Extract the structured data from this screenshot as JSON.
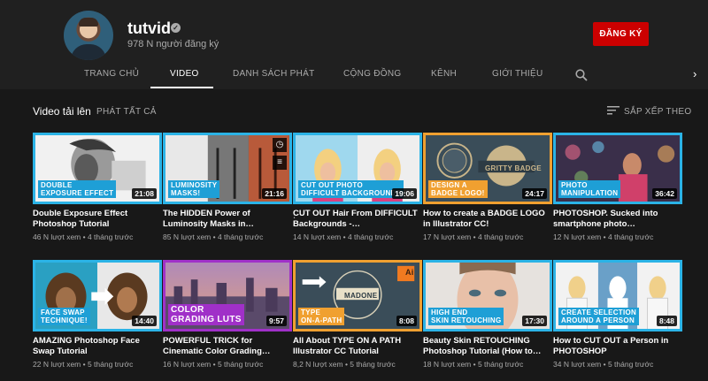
{
  "channel": {
    "name": "tutvid",
    "subscribers": "978 N người đăng ký",
    "subscribe_label": "ĐĂNG KÝ"
  },
  "tabs": [
    {
      "label": "TRANG CHỦ"
    },
    {
      "label": "VIDEO"
    },
    {
      "label": "DANH SÁCH PHÁT"
    },
    {
      "label": "CỘNG ĐỒNG"
    },
    {
      "label": "KÊNH"
    },
    {
      "label": "GIỚI THIỆU"
    }
  ],
  "active_tab": "VIDEO",
  "section": {
    "title": "Video tải lên",
    "play_all": "PHÁT TẤT CẢ",
    "sort_label": "SẮP XẾP THEO"
  },
  "icons": [
    "verified-check-icon",
    "search-icon",
    "chevron-right-icon",
    "sort-icon",
    "clock-icon",
    "add-to-queue-icon",
    "kebab-menu-icon"
  ],
  "videos": [
    {
      "title": "Double Exposure Effect Photoshop Tutorial",
      "meta": "46 N lượt xem • 4 tháng trước",
      "duration": "21:08",
      "badge": "DOUBLE\nEXPOSURE EFFECT"
    },
    {
      "title": "The HIDDEN Power of Luminosity Masks in…",
      "meta": "85 N lượt xem • 4 tháng trước",
      "duration": "21:16",
      "badge": "LUMINOSITY\nMASKS!"
    },
    {
      "title": "CUT OUT Hair From DIFFICULT Backgrounds -…",
      "meta": "14 N lượt xem • 4 tháng trước",
      "duration": "19:06",
      "badge": "CUT OUT PHOTO\nDIFFICULT BACKGROUNDS"
    },
    {
      "title": "How to create a BADGE LOGO in Illustrator CC!",
      "meta": "17 N lượt xem • 4 tháng trước",
      "duration": "24:17",
      "badge": "DESIGN A\nBADGE LOGO!",
      "art_text": "GRITTY BADGE"
    },
    {
      "title": "PHOTOSHOP. Sucked into smartphone photo…",
      "meta": "12 N lượt xem • 4 tháng trước",
      "duration": "36:42",
      "badge": "PHOTO\nMANIPULATION"
    },
    {
      "title": "AMAZING Photoshop Face Swap Tutorial",
      "meta": "22 N lượt xem • 5 tháng trước",
      "duration": "14:40",
      "badge": "FACE SWAP\nTECHNIQUE!"
    },
    {
      "title": "POWERFUL TRICK for Cinematic Color Grading…",
      "meta": "16 N lượt xem • 5 tháng trước",
      "duration": "9:57",
      "badge": "COLOR\nGRADING LUTS"
    },
    {
      "title": "All About TYPE ON A PATH Illustrator CC Tutorial",
      "meta": "8,2 N lượt xem • 5 tháng trước",
      "duration": "8:08",
      "badge": "TYPE\nON-A-PATH",
      "art_text": "MADONE"
    },
    {
      "title": "Beauty Skin RETOUCHING Photoshop Tutorial (How to…",
      "meta": "18 N lượt xem • 5 tháng trước",
      "duration": "17:30",
      "badge": "HIGH END\nSKIN RETOUCHING"
    },
    {
      "title": "How to CUT OUT a Person in PHOTOSHOP",
      "meta": "34 N lượt xem • 5 tháng trước",
      "duration": "8:48",
      "badge": "CREATE SELECTION\nAROUND A PERSON"
    }
  ]
}
